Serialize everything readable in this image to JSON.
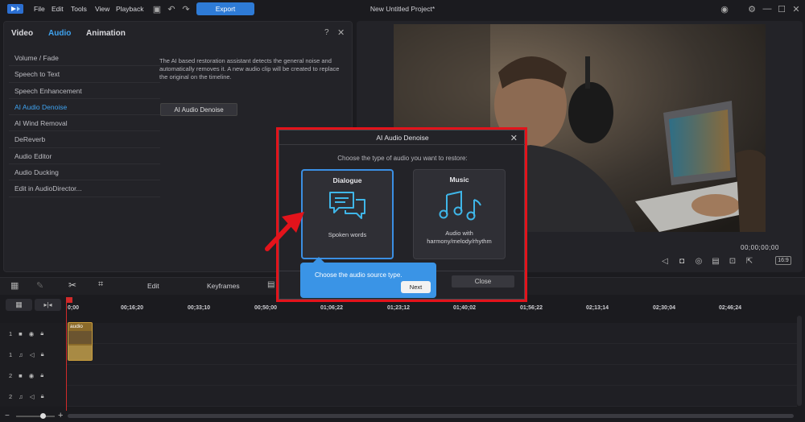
{
  "menu": [
    "File",
    "Edit",
    "Tools",
    "View",
    "Playback"
  ],
  "export_label": "Export",
  "project_title": "New Untitled Project*",
  "panel": {
    "tabs": [
      "Video",
      "Audio",
      "Animation"
    ],
    "active_tab": "Audio",
    "items": [
      "Volume / Fade",
      "Speech to Text",
      "Speech Enhancement",
      "AI Audio Denoise",
      "AI Wind Removal",
      "DeReverb",
      "Audio Editor",
      "Audio Ducking",
      "Edit in AudioDirector..."
    ],
    "active_item": "AI Audio Denoise",
    "description": "The AI based restoration assistant detects the general noise and automatically removes it. A new audio clip will be created to replace the original on the timeline.",
    "button_label": "AI Audio Denoise"
  },
  "preview": {
    "timecode": "00;00;00;00",
    "aspect": "16:9"
  },
  "timeline": {
    "toolbar": {
      "edit": "Edit",
      "keyframes": "Keyframes"
    },
    "ruler": [
      "0;00",
      "00;16;20",
      "00;33;10",
      "00;50;00",
      "01;06;22",
      "01;23;12",
      "01;40;02",
      "01;56;22",
      "02;13;14",
      "02;30;04",
      "02;46;24"
    ],
    "tracks": [
      {
        "num": "1",
        "type": "video"
      },
      {
        "num": "1",
        "type": "audio"
      },
      {
        "num": "2",
        "type": "video"
      },
      {
        "num": "2",
        "type": "audio"
      }
    ],
    "clip_label": "audio"
  },
  "dialog": {
    "title": "AI Audio Denoise",
    "subtitle": "Choose the type of audio you want to restore:",
    "cards": [
      {
        "title": "Dialogue",
        "desc": "Spoken words",
        "icon": "chat-bubbles-icon",
        "selected": true
      },
      {
        "title": "Music",
        "desc": "Audio with harmony/melody/rhythm",
        "icon": "music-notes-icon",
        "selected": false
      }
    ],
    "close_label": "Close"
  },
  "tooltip": {
    "text": "Choose the audio source type.",
    "next_label": "Next"
  },
  "colors": {
    "accent": "#3fa3f0",
    "highlight_frame": "#e3131b",
    "tooltip": "#3a94e6"
  }
}
